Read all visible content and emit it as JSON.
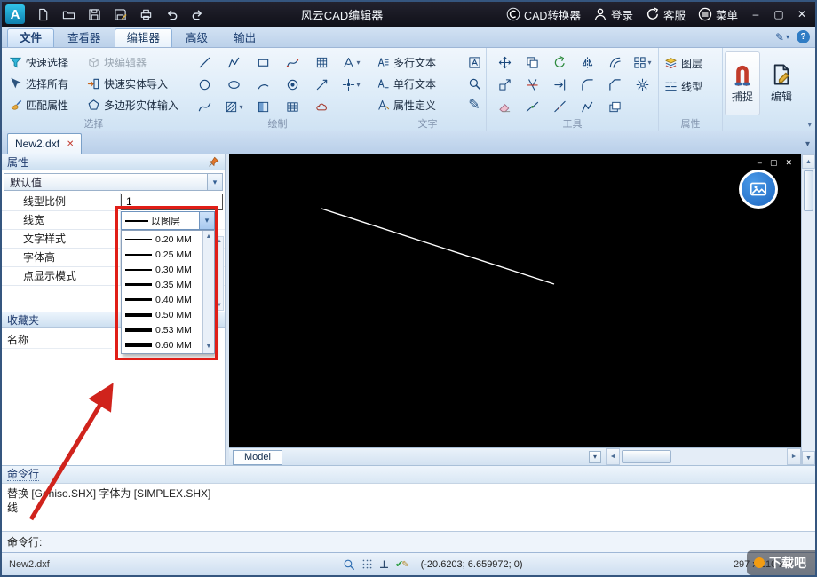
{
  "window": {
    "title": "风云CAD编辑器",
    "app_logo": "A",
    "controls": {
      "minimize": "–",
      "maximize": "▢",
      "close": "✕"
    }
  },
  "titlebar": {
    "items": [
      {
        "label": "CAD转换器"
      },
      {
        "label": "登录"
      },
      {
        "label": "客服"
      },
      {
        "label": "菜单"
      }
    ]
  },
  "tabs": [
    {
      "label": "文件"
    },
    {
      "label": "查看器"
    },
    {
      "label": "编辑器"
    },
    {
      "label": "高级"
    },
    {
      "label": "输出"
    }
  ],
  "ribbon": {
    "select_group": {
      "label": "选择",
      "quick_select": "快速选择",
      "block_editor": "块编辑器",
      "select_all": "选择所有",
      "quick_entity_import": "快速实体导入",
      "match_properties": "匹配属性",
      "polygon_entity_input": "多边形实体输入"
    },
    "draw_group": {
      "label": "绘制"
    },
    "text_group": {
      "label": "文字",
      "multiline_text": "多行文本",
      "singleline_text": "单行文本",
      "attribute_define": "属性定义"
    },
    "tools_group": {
      "label": "工具"
    },
    "props_group": {
      "label": "属性",
      "layers": "图层",
      "linetype": "线型"
    },
    "snap_button": "捕捉",
    "edit_button": "编辑"
  },
  "document_tab": {
    "label": "New2.dxf"
  },
  "properties_panel": {
    "header": "属性",
    "preset": "默认值",
    "rows": [
      {
        "label": "线型比例",
        "value": "1"
      },
      {
        "label": "线宽",
        "value": ""
      },
      {
        "label": "文字样式",
        "value": ""
      },
      {
        "label": "字体高",
        "value": ""
      },
      {
        "label": "点显示模式",
        "value": ""
      }
    ],
    "favorites_header": "收藏夹",
    "name_label": "名称",
    "lineweight_dropdown": {
      "selected_label": "以图层",
      "options": [
        {
          "label": "0.20 MM"
        },
        {
          "label": "0.25 MM"
        },
        {
          "label": "0.30 MM"
        },
        {
          "label": "0.35 MM"
        },
        {
          "label": "0.40 MM"
        },
        {
          "label": "0.50 MM"
        },
        {
          "label": "0.53 MM"
        },
        {
          "label": "0.60 MM"
        }
      ]
    }
  },
  "canvas": {
    "model_tab": "Model"
  },
  "command_panel": {
    "header": "命令行",
    "history_line1": "替换 [Geniso.SHX] 字体为 [SIMPLEX.SHX]",
    "history_line2": "线",
    "prompt_label": "命令行:"
  },
  "statusbar": {
    "file_name": "New2.dxf",
    "coordinates": "(-20.6203; 6.659972; 0)",
    "sheet_size": "297 x 210 x 0"
  },
  "watermark": {
    "text": "下载吧"
  },
  "icons": {
    "dropdown_arrow": "▾",
    "scroll_up": "▲",
    "scroll_down": "▼",
    "scroll_left": "◄",
    "scroll_right": "►",
    "close_small": "✕",
    "minimize_small": "–",
    "restore_small": "▢",
    "help": "?",
    "pencil": "✎",
    "check": "✔",
    "perpendicular": "⊥"
  },
  "colors": {
    "annotation_red": "#d0231c",
    "canvas_bg": "#000000",
    "titlebar_bg": "#15151d"
  }
}
